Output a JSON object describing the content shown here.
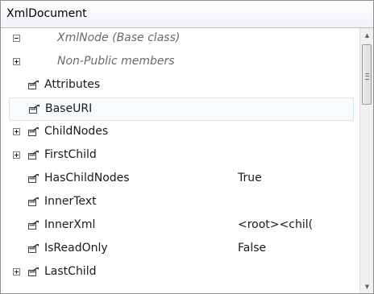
{
  "window": {
    "title": "XmlDocument"
  },
  "rows": [
    {
      "name": "XmlNode (Base class)",
      "value": "",
      "expander": "minus",
      "icon": "none",
      "group": true,
      "selected": false
    },
    {
      "name": "Non-Public members",
      "value": "",
      "expander": "plus",
      "icon": "none",
      "group": true,
      "selected": false
    },
    {
      "name": "Attributes",
      "value": "",
      "expander": "none",
      "icon": "property-icon",
      "group": false,
      "selected": false
    },
    {
      "name": "BaseURI",
      "value": "",
      "expander": "none",
      "icon": "property-icon",
      "group": false,
      "selected": true
    },
    {
      "name": "ChildNodes",
      "value": "",
      "expander": "plus",
      "icon": "property-icon",
      "group": false,
      "selected": false
    },
    {
      "name": "FirstChild",
      "value": "",
      "expander": "plus",
      "icon": "property-icon",
      "group": false,
      "selected": false
    },
    {
      "name": "HasChildNodes",
      "value": "True",
      "expander": "none",
      "icon": "property-icon",
      "group": false,
      "selected": false
    },
    {
      "name": "InnerText",
      "value": "",
      "expander": "none",
      "icon": "property-icon",
      "group": false,
      "selected": false
    },
    {
      "name": "InnerXml",
      "value": "<root><chil(",
      "expander": "none",
      "icon": "property-icon",
      "group": false,
      "selected": false
    },
    {
      "name": "IsReadOnly",
      "value": "False",
      "expander": "none",
      "icon": "property-icon",
      "group": false,
      "selected": false
    },
    {
      "name": "LastChild",
      "value": "",
      "expander": "plus",
      "icon": "property-icon",
      "group": false,
      "selected": false
    }
  ],
  "scrollbar": {
    "up_icon": "scroll-up-arrow-icon",
    "down_icon": "scroll-down-arrow-icon",
    "thumb_icon": "scroll-grip-icon"
  },
  "colors": {
    "selection_fill": "#f7fcfe",
    "selection_border": "#cde6f4",
    "group_text": "#6a6a6a"
  }
}
